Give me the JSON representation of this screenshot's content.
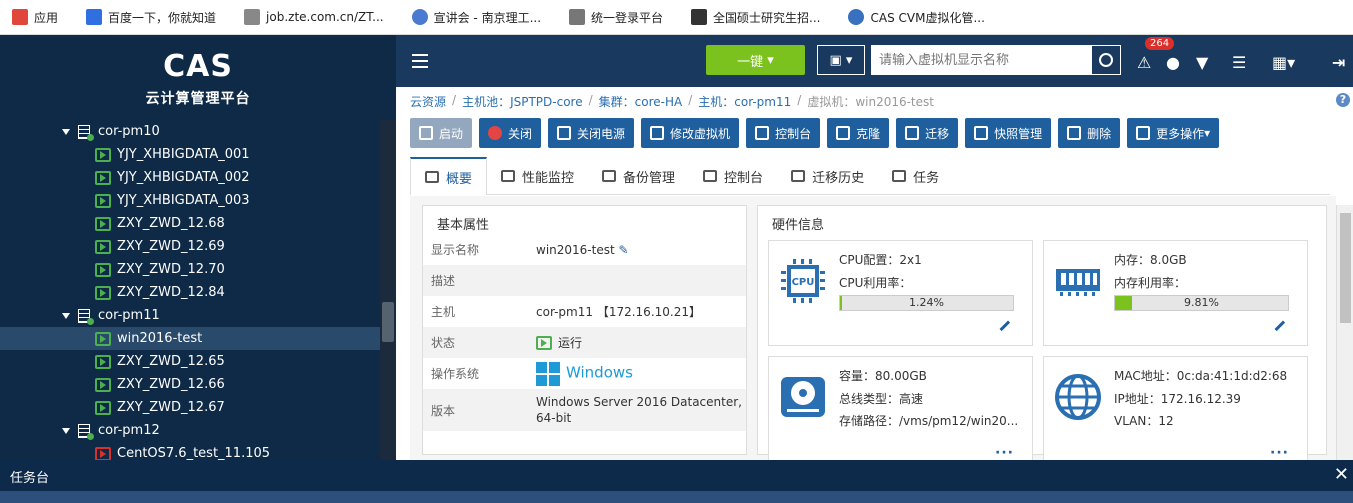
{
  "bookmarks": [
    {
      "icon": "apps-icon",
      "label": "应用"
    },
    {
      "icon": "baidu-icon",
      "label": "百度一下，你就知道"
    },
    {
      "icon": "page-icon",
      "label": "job.zte.com.cn/ZT..."
    },
    {
      "icon": "globe-icon",
      "label": "宣讲会 - 南京理工..."
    },
    {
      "icon": "doc-icon",
      "label": "统一登录平台"
    },
    {
      "icon": "graduate-icon",
      "label": "全国硕士研究生招..."
    },
    {
      "icon": "cas-icon",
      "label": "CAS CVM虚拟化管..."
    }
  ],
  "logo": {
    "text": "CAS",
    "subtitle": "云计算管理平台"
  },
  "tree": [
    {
      "type": "host",
      "label": "cor-pm10"
    },
    {
      "type": "vm",
      "label": "YJY_XHBIGDATA_001",
      "status": "running"
    },
    {
      "type": "vm",
      "label": "YJY_XHBIGDATA_002",
      "status": "running"
    },
    {
      "type": "vm",
      "label": "YJY_XHBIGDATA_003",
      "status": "running"
    },
    {
      "type": "vm",
      "label": "ZXY_ZWD_12.68",
      "status": "running"
    },
    {
      "type": "vm",
      "label": "ZXY_ZWD_12.69",
      "status": "running"
    },
    {
      "type": "vm",
      "label": "ZXY_ZWD_12.70",
      "status": "running"
    },
    {
      "type": "vm",
      "label": "ZXY_ZWD_12.84",
      "status": "running"
    },
    {
      "type": "host",
      "label": "cor-pm11"
    },
    {
      "type": "vm",
      "label": "win2016-test",
      "status": "running",
      "selected": true
    },
    {
      "type": "vm",
      "label": "ZXY_ZWD_12.65",
      "status": "running"
    },
    {
      "type": "vm",
      "label": "ZXY_ZWD_12.66",
      "status": "running"
    },
    {
      "type": "vm",
      "label": "ZXY_ZWD_12.67",
      "status": "running"
    },
    {
      "type": "host",
      "label": "cor-pm12"
    },
    {
      "type": "vm",
      "label": "CentOS7.6_test_11.105",
      "status": "stopped"
    }
  ],
  "topbar": {
    "onekey": "一键",
    "search_placeholder": "请输入虚拟机显示名称",
    "alert_count": "264"
  },
  "breadcrumb": [
    "云资源",
    "主机池：JSPTPD-core",
    "集群：core-HA",
    "主机：cor-pm11",
    "虚拟机：win2016-test"
  ],
  "actions": [
    {
      "label": "启动",
      "disabled": true
    },
    {
      "label": "关闭"
    },
    {
      "label": "关闭电源"
    },
    {
      "label": "修改虚拟机"
    },
    {
      "label": "控制台"
    },
    {
      "label": "克隆"
    },
    {
      "label": "迁移"
    },
    {
      "label": "快照管理"
    },
    {
      "label": "删除"
    },
    {
      "label": "更多操作"
    }
  ],
  "tabs": [
    "概要",
    "性能监控",
    "备份管理",
    "控制台",
    "迁移历史",
    "任务"
  ],
  "basic": {
    "title": "基本属性",
    "rows": [
      {
        "k": "显示名称",
        "v": "win2016-test"
      },
      {
        "k": "描述",
        "v": ""
      },
      {
        "k": "主机",
        "v": "cor-pm11 【172.16.10.21】"
      },
      {
        "k": "状态",
        "v": "运行"
      },
      {
        "k": "操作系统",
        "v": "Windows"
      },
      {
        "k": "版本",
        "v": "Windows Server 2016 Datacenter, 64-bit"
      }
    ]
  },
  "hw": {
    "title": "硬件信息",
    "cpu": {
      "config": "CPU配置：2x1",
      "usage_label": "CPU利用率：",
      "usage": "1.24%",
      "usage_value": 1.24
    },
    "mem": {
      "size": "内存：8.0GB",
      "usage_label": "内存利用率：",
      "usage": "9.81%",
      "usage_value": 9.81
    },
    "disk": {
      "capacity": "容量：80.00GB",
      "bus": "总线类型：高速",
      "path": "存储路径：/vms/pm12/win20..."
    },
    "net": {
      "mac": "MAC地址：0c:da:41:1d:d2:68",
      "ip": "IP地址：172.16.12.39",
      "vlan": "VLAN：12"
    }
  },
  "taskbar": {
    "title": "任务台"
  }
}
